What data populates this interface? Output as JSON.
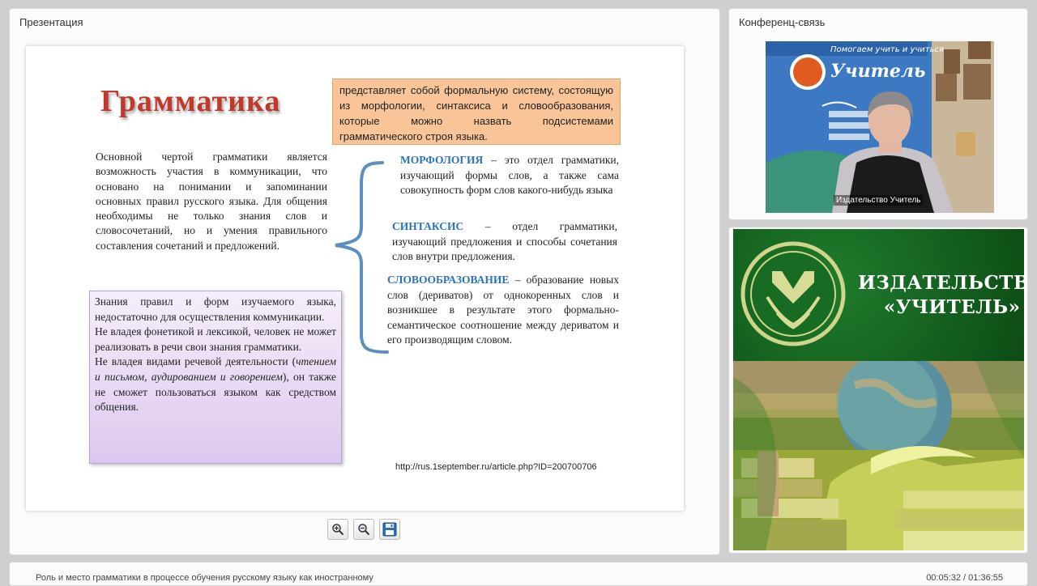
{
  "presentation": {
    "panel_title": "Презентация",
    "slide": {
      "title": "Грамматика",
      "definition": "представляет собой формальную систему, состоящую из морфологии, синтаксиса и словообразования, которые можно назвать подсистемами грамматического строя языка.",
      "main_text": "Основной чертой грамматики является возможность участия в коммуникации, что основано на понимании и запоминании основных правил русского языка. Для общения необходимы не только знания слов и словосочетаний, но и умения правильного составления сочетаний и предложений.",
      "knowledge": {
        "p1": "Знания правил и форм изучаемого языка, недостаточно для осуществления коммуникации.",
        "p2": "Не владея фонетикой и лексикой, человек не может реализовать в речи свои знания грамматики.",
        "p3_start": "Не владея видами речевой деятельности (",
        "p3_italic": "чтением и письмом, аудированием и говорением",
        "p3_end": "), он также не сможет пользоваться языком как средством общения."
      },
      "morphology": {
        "term": "МОРФОЛОГИЯ",
        "text": " – это отдел грамматики, изучающий формы слов, а также сама совокупность форм слов какого-нибудь языка"
      },
      "syntax": {
        "term": "СИНТАКСИС",
        "text": " – отдел грамматики, изучающий предложения и способы сочетания слов внутри предложения."
      },
      "word_formation": {
        "term": "СЛОВООБРАЗОВАНИЕ",
        "text": " – образование новых слов (дериватов) от однокоренных слов и возникшее в результате этого формально-семантическое соотношение между дериватом и его производящим словом."
      },
      "source_url": "http://rus.1september.ru/article.php?ID=200700706"
    },
    "toolbar": {
      "zoom_in_icon": "zoom-in-icon",
      "zoom_out_icon": "zoom-out-icon",
      "save_icon": "floppy-disk-icon"
    }
  },
  "conference": {
    "panel_title": "Конференц-связь",
    "video_caption": "Издательство Учитель",
    "backdrop": {
      "line1": "Помогаем учить и учиться",
      "brand": "Учитель"
    }
  },
  "publisher": {
    "line1": "ИЗДАТЕЛЬСТВО",
    "line2": "«УЧИТЕЛЬ»"
  },
  "footer": {
    "lecture_title": "Роль и место грамматики в процессе обучения русскому языку как иностранному",
    "time": "00:05:32 / 01:36:55"
  },
  "colors": {
    "title_red": "#c0392b",
    "term_blue": "#2a73b8",
    "definition_bg": "#f9c598",
    "knowledge_bg": "#dcc8ee",
    "publisher_green": "#0c4c15"
  }
}
